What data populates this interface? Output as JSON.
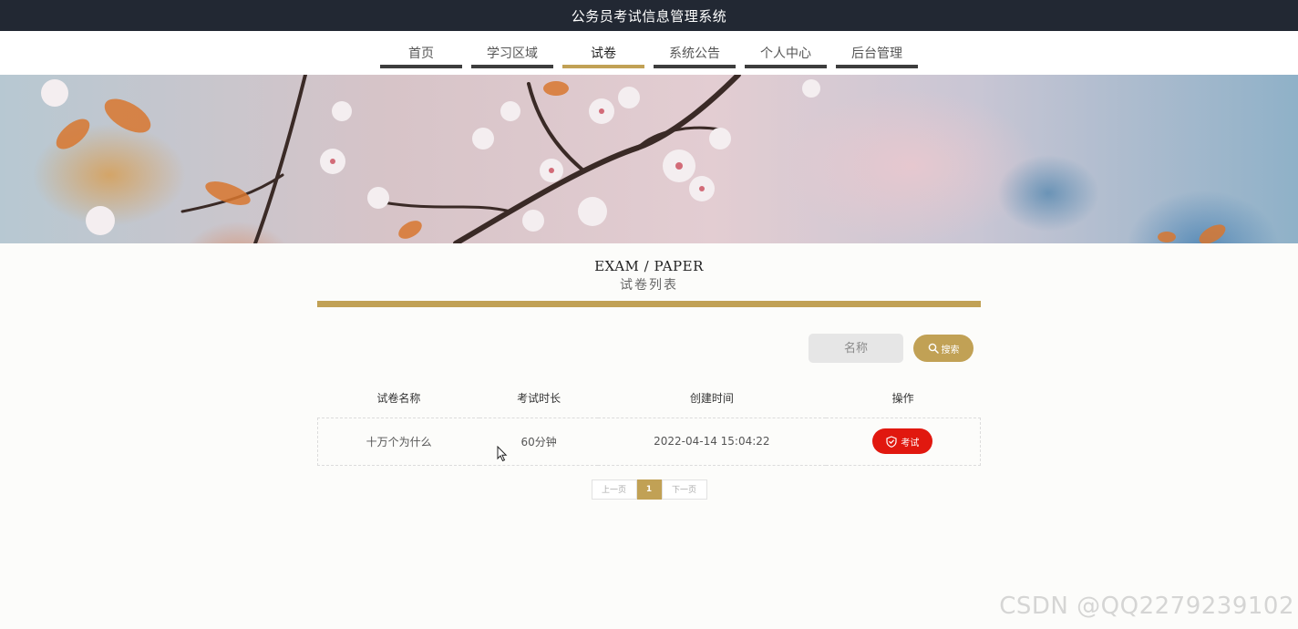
{
  "header": {
    "title": "公务员考试信息管理系统"
  },
  "nav": {
    "items": [
      {
        "label": "首页"
      },
      {
        "label": "学习区域"
      },
      {
        "label": "试卷"
      },
      {
        "label": "系统公告"
      },
      {
        "label": "个人中心"
      },
      {
        "label": "后台管理"
      }
    ],
    "active_index": 2
  },
  "section": {
    "title_en": "EXAM / PAPER",
    "title_cn": "试卷列表"
  },
  "search": {
    "placeholder": "名称",
    "button_label": "搜索"
  },
  "table": {
    "headers": [
      "试卷名称",
      "考试时长",
      "创建时间",
      "操作"
    ],
    "rows": [
      {
        "name": "十万个为什么",
        "duration": "60分钟",
        "created": "2022-04-14 15:04:22",
        "action_label": "考试"
      }
    ]
  },
  "pagination": {
    "prev_label": "上一页",
    "current_page": "1",
    "next_label": "下一页"
  },
  "watermark": "CSDN @QQ2279239102",
  "colors": {
    "accent": "#c1a155",
    "topbar": "#222833",
    "danger": "#e1180f"
  }
}
